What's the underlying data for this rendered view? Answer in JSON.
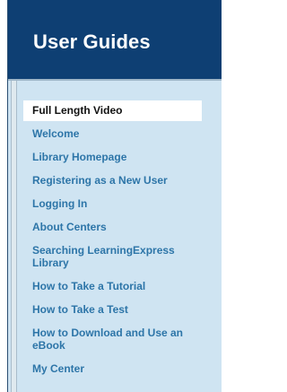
{
  "header": {
    "title": "User Guides"
  },
  "nav": {
    "items": [
      {
        "label": "Full Length Video"
      },
      {
        "label": "Welcome"
      },
      {
        "label": "Library Homepage"
      },
      {
        "label": "Registering as a New User"
      },
      {
        "label": "Logging In"
      },
      {
        "label": "About Centers"
      },
      {
        "label": "Searching LearningExpress Library"
      },
      {
        "label": "How to Take a Tutorial"
      },
      {
        "label": "How to Take a Test"
      },
      {
        "label": "How to Download and Use an eBook"
      },
      {
        "label": "My Center"
      }
    ],
    "active_index": 0
  },
  "colors": {
    "header_bg": "#0e3f73",
    "body_bg": "#cfe4f2",
    "link": "#2d75a8",
    "active_text": "#111111"
  }
}
